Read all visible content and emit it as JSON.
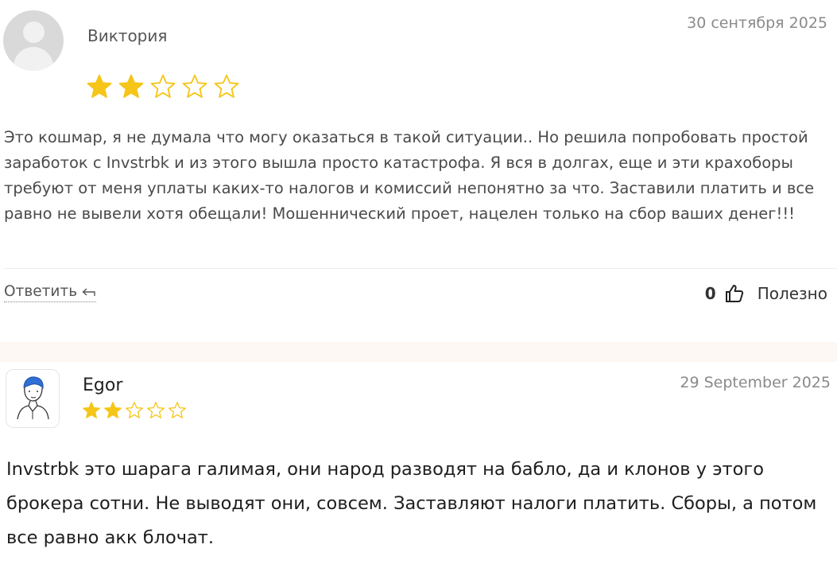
{
  "reviews": [
    {
      "author": "Виктория",
      "date": "30 сентября 2025",
      "rating": 2,
      "max_rating": 5,
      "text": "Это кошмар, я не думала что могу оказаться в такой ситуации.. Но решила попробовать простой заработок с Invstrbk и из этого вышла просто катастрофа. Я вся в долгах, еще и эти крахоборы требуют от меня уплаты каких-то налогов и комиссий непонятно за что. Заставили платить и все равно не вывели хотя обещали! Мошеннический проет, нацелен только на сбор ваших денег!!!",
      "reply_label": "Ответить",
      "helpful_count": "0",
      "helpful_label": "Полезно"
    },
    {
      "author": "Egor",
      "date": "29 September 2025",
      "rating": 2,
      "max_rating": 5,
      "text": "Invstrbk это шарага галимая, они народ разводят на бабло, да и клонов у этого брокера сотни. Не выводят они, совсем. Заставляют налоги платить. Сборы, а потом все равно акк блочат."
    }
  ],
  "colors": {
    "star_filled": "#f5c518",
    "star_empty_stroke": "#f5c518"
  },
  "icons": {
    "reply": "reply-arrow-icon",
    "helpful": "thumbs-up-icon",
    "avatar_default": "default-avatar-icon",
    "avatar_sketch": "sketch-avatar-icon"
  }
}
